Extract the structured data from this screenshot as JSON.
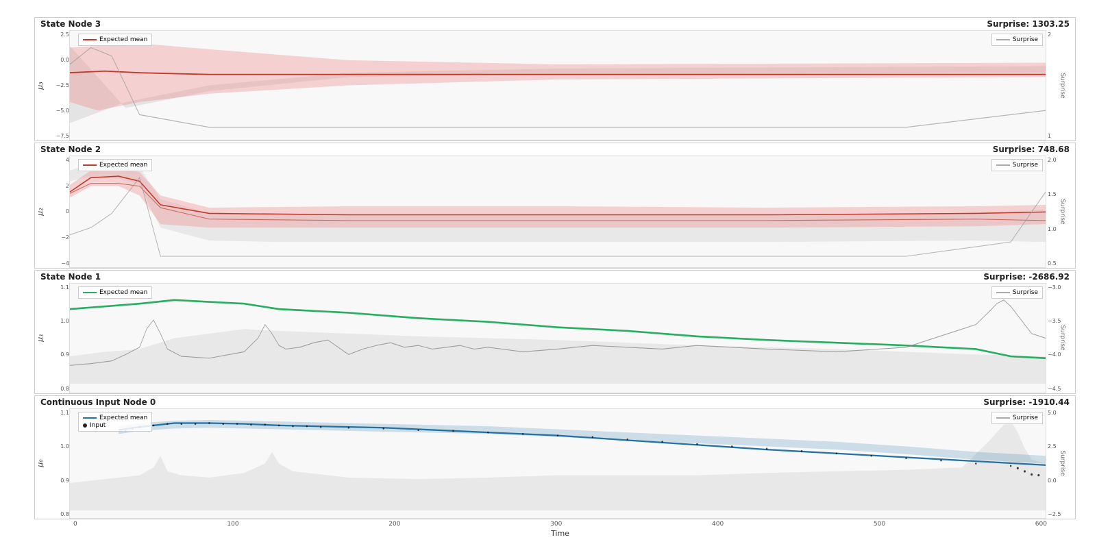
{
  "panels": [
    {
      "id": "panel-node3",
      "title": "State Node 3",
      "surprise_label": "Surprise: 1303.25",
      "y_axis_label": "μ₃",
      "y_ticks": [
        "2.5",
        "0.0",
        "-2.5",
        "-5.0",
        "-7.5"
      ],
      "right_ticks": [
        "2",
        "1"
      ],
      "legend": [
        {
          "type": "line",
          "color": "#c0392b",
          "label": "Expected mean"
        }
      ],
      "has_surprise_legend": true,
      "chart_type": "node3"
    },
    {
      "id": "panel-node2",
      "title": "State Node 2",
      "surprise_label": "Surprise: 748.68",
      "y_axis_label": "μ₂",
      "y_ticks": [
        "4",
        "2",
        "0",
        "-2",
        "-4"
      ],
      "right_ticks": [
        "2.0",
        "1.5",
        "1.0",
        "0.5"
      ],
      "legend": [
        {
          "type": "line",
          "color": "#c0392b",
          "label": "Expected mean"
        }
      ],
      "has_surprise_legend": true,
      "chart_type": "node2"
    },
    {
      "id": "panel-node1",
      "title": "State Node 1",
      "surprise_label": "Surprise: -2686.92",
      "y_axis_label": "μ₁",
      "y_ticks": [
        "1.1",
        "1.0",
        "0.9",
        "0.8"
      ],
      "right_ticks": [
        "-3.0",
        "-3.5",
        "-4.0",
        "-4.5"
      ],
      "legend": [
        {
          "type": "line",
          "color": "#27ae60",
          "label": "Expected mean"
        }
      ],
      "has_surprise_legend": true,
      "chart_type": "node1"
    },
    {
      "id": "panel-node0",
      "title": "Continuous Input Node 0",
      "surprise_label": "Surprise: -1910.44",
      "y_axis_label": "μ₀",
      "y_ticks": [
        "1.1",
        "1.0",
        "0.9",
        "0.8"
      ],
      "right_ticks": [
        "5.0",
        "2.5",
        "0.0",
        "-2.5"
      ],
      "legend": [
        {
          "type": "line",
          "color": "#2471a3",
          "label": "Expected mean"
        },
        {
          "type": "dot",
          "color": "#222",
          "label": "Input"
        }
      ],
      "has_surprise_legend": true,
      "chart_type": "node0"
    }
  ],
  "x_ticks": [
    "0",
    "100",
    "200",
    "300",
    "400",
    "500",
    "600"
  ],
  "x_label": "Time",
  "surprise_legend_label": "Surprise"
}
